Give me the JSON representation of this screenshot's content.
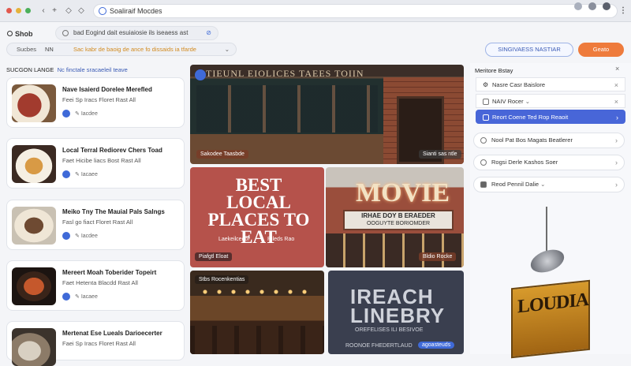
{
  "browser": {
    "url": "Soaliraif Mocdes"
  },
  "header": {
    "brand": "Shob",
    "query": "bad Eogind dait esuiaiosie ils iseaess ast",
    "filter_label": "Sucbes",
    "filter_tag": "NN",
    "filter_query": "Sac kabr de baoig de ance fo dissaids ia tfarde",
    "btn_outline": "SINGIVAESS NASTIAR",
    "btn_orange": "Geato"
  },
  "left": {
    "title_a": "SUCGON LANGE",
    "title_b": "Nc finctale sracaeleil teave",
    "cards": [
      {
        "title": "Nave Isaierd Dorelee Merefled",
        "sub": "Feei Sp Iracs Floret Rast All",
        "meta": "Iacdee"
      },
      {
        "title": "Local Terral Rediorev Chers Toad",
        "sub": "Faet Hicibe liacs Bost Rast All",
        "meta": "Iacaee"
      },
      {
        "title": "Meiko Tny The Mauial Pals Salngs",
        "sub": "Fasl go fiact Floret Rast All",
        "meta": "Iacdee"
      },
      {
        "title": "Mereert Moah Toberider Topeirt",
        "sub": "Faet Hetenta Blacdd Rast All",
        "meta": "Iacaee"
      },
      {
        "title": "Mertenat Ese Lueals Darioecerter",
        "sub": "Faei Sp Iracs Floret Rast All",
        "meta": ""
      }
    ]
  },
  "grid": {
    "t1_sign": "TIEUNL EIOLICES TAEES TOIIN",
    "t1_cap": "Sakodee Taasbde",
    "t1_cap2": "Sianti sas ntle",
    "t2_text": "BEST LOCAL PLACES TO EAT",
    "t2_sub1": "Laekeilcedor",
    "t2_sub2": "Rileds Rao",
    "t2_cap": "Piafgtl Eloat",
    "t3_text": "MOVIE",
    "t3_marquee1": "IRHAE DOY B ERAEDER",
    "t3_marquee2": "OOGUYTE BORIOMDER",
    "t3_cap": "Bldio Rocke",
    "t4_cap": "Stbs Rocenkentias",
    "t5_text1": "IREACH",
    "t5_text2": "LINEBRY",
    "t5_sub": "OREFELISES ILI BESIVOE",
    "t5_cap": "ROONOE FHEDERTLAUD",
    "t5_badge": "agoasteuds"
  },
  "right": {
    "title": "Meritore Bstay",
    "options": [
      "Nasre Casr Baislore",
      "NAIV Rocer",
      "Reort Coene Ted Rop Reaoit"
    ],
    "boxes": [
      "Nool Pat Bos Magats Beatlerer",
      "Rogsi Derle Kashos Soer",
      "Reod Pennil Dalie"
    ],
    "sign": "LOUDIA"
  }
}
